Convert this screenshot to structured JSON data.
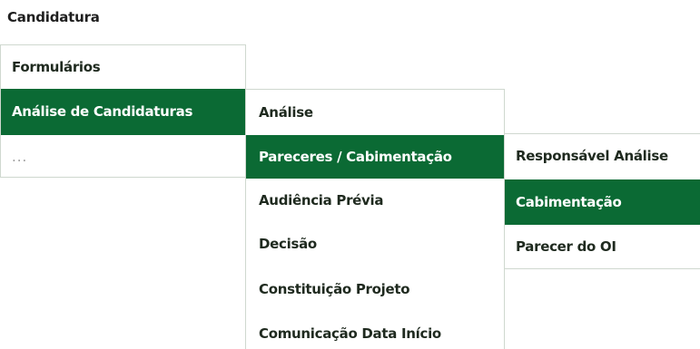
{
  "title": "Candidatura",
  "level1": {
    "items": [
      "Formulários",
      "Análise de Candidaturas",
      "..."
    ]
  },
  "level2": {
    "items": [
      "Análise",
      "Pareceres / Cabimentação",
      "Audiência Prévia",
      "Decisão",
      "Constituição Projeto",
      "Comunicação Data Início"
    ]
  },
  "level3": {
    "items": [
      "Responsável Análise",
      "Cabimentação",
      "Parecer do OI"
    ]
  },
  "colors": {
    "active_bg": "#0b6a34",
    "active_text": "#ffffff"
  }
}
